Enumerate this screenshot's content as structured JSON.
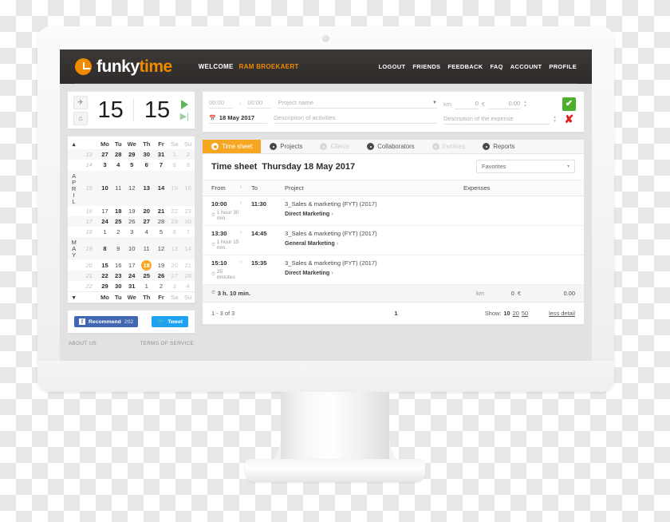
{
  "brand": {
    "logo_first": "funky",
    "logo_second": "time",
    "accent_color": "#f5a623",
    "header_color": "#2e2b2a"
  },
  "topbar": {
    "welcome_label": "WELCOME",
    "user_name": "RAM BROEKAERT",
    "nav": [
      "LOGOUT",
      "FRIENDS",
      "FEEDBACK",
      "FAQ",
      "ACCOUNT",
      "PROFILE"
    ]
  },
  "timer": {
    "plane_icon": "airplane-icon",
    "home_icon": "home-icon",
    "digit_left": "15",
    "digit_right": "15",
    "play_icon": "play-icon",
    "skip_icon": "skip-icon"
  },
  "entry_form": {
    "from_time": "00:00",
    "arrow": "›",
    "to_time": "00:00",
    "project_placeholder": "Project name",
    "date_value": "18 May 2017",
    "activity_placeholder": "Description of activities",
    "km_label": "km",
    "km_value": "0",
    "currency_label": "€",
    "amount_value": "0.00",
    "expense_placeholder": "Description of the expense",
    "confirm_glyph": "✔",
    "cancel_glyph": "✘"
  },
  "calendar": {
    "weekdays": [
      "Mo",
      "Tu",
      "We",
      "Th",
      "Fr",
      "Sa",
      "Su"
    ],
    "nav_up": "▴",
    "nav_down": "▾",
    "months": [
      "APRIL",
      "MAY"
    ],
    "rows": [
      {
        "week": "13",
        "month": "",
        "days": [
          {
            "d": "27",
            "style": "bold"
          },
          {
            "d": "28",
            "style": "bold"
          },
          {
            "d": "29",
            "style": "bold"
          },
          {
            "d": "30",
            "style": "bold"
          },
          {
            "d": "31",
            "style": "bold"
          },
          {
            "d": "1",
            "style": "dim"
          },
          {
            "d": "2",
            "style": "dim"
          }
        ]
      },
      {
        "week": "14",
        "month": "",
        "days": [
          {
            "d": "3",
            "style": "bold"
          },
          {
            "d": "4",
            "style": "bold"
          },
          {
            "d": "5",
            "style": "bold"
          },
          {
            "d": "6",
            "style": "bold"
          },
          {
            "d": "7",
            "style": "bold"
          },
          {
            "d": "8",
            "style": "dim"
          },
          {
            "d": "9",
            "style": "dim"
          }
        ]
      },
      {
        "week": "15",
        "month": "APRIL",
        "days": [
          {
            "d": "10",
            "style": "bold"
          },
          {
            "d": "11",
            "style": "normal"
          },
          {
            "d": "12",
            "style": "normal"
          },
          {
            "d": "13",
            "style": "bold"
          },
          {
            "d": "14",
            "style": "bold"
          },
          {
            "d": "15",
            "style": "dim"
          },
          {
            "d": "16",
            "style": "dim"
          }
        ]
      },
      {
        "week": "16",
        "month": "",
        "days": [
          {
            "d": "17",
            "style": "normal"
          },
          {
            "d": "18",
            "style": "bold"
          },
          {
            "d": "19",
            "style": "normal"
          },
          {
            "d": "20",
            "style": "bold"
          },
          {
            "d": "21",
            "style": "bold"
          },
          {
            "d": "22",
            "style": "dim"
          },
          {
            "d": "23",
            "style": "dim"
          }
        ]
      },
      {
        "week": "17",
        "month": "",
        "days": [
          {
            "d": "24",
            "style": "bold"
          },
          {
            "d": "25",
            "style": "bold"
          },
          {
            "d": "26",
            "style": "normal"
          },
          {
            "d": "27",
            "style": "bold"
          },
          {
            "d": "28",
            "style": "normal"
          },
          {
            "d": "29",
            "style": "dim"
          },
          {
            "d": "30",
            "style": "dim"
          }
        ]
      },
      {
        "week": "18",
        "month": "",
        "days": [
          {
            "d": "1",
            "style": "normal"
          },
          {
            "d": "2",
            "style": "normal"
          },
          {
            "d": "3",
            "style": "normal"
          },
          {
            "d": "4",
            "style": "normal"
          },
          {
            "d": "5",
            "style": "normal"
          },
          {
            "d": "6",
            "style": "dim"
          },
          {
            "d": "7",
            "style": "dim"
          }
        ]
      },
      {
        "week": "19",
        "month": "MAY",
        "days": [
          {
            "d": "8",
            "style": "bold"
          },
          {
            "d": "9",
            "style": "normal"
          },
          {
            "d": "10",
            "style": "normal"
          },
          {
            "d": "11",
            "style": "normal"
          },
          {
            "d": "12",
            "style": "normal"
          },
          {
            "d": "13",
            "style": "dim"
          },
          {
            "d": "14",
            "style": "dim"
          }
        ]
      },
      {
        "week": "20",
        "month": "",
        "days": [
          {
            "d": "15",
            "style": "bold"
          },
          {
            "d": "16",
            "style": "normal"
          },
          {
            "d": "17",
            "style": "normal"
          },
          {
            "d": "18",
            "style": "selected"
          },
          {
            "d": "19",
            "style": "normal"
          },
          {
            "d": "20",
            "style": "dim"
          },
          {
            "d": "21",
            "style": "dim"
          }
        ]
      },
      {
        "week": "21",
        "month": "",
        "days": [
          {
            "d": "22",
            "style": "bold"
          },
          {
            "d": "23",
            "style": "bold"
          },
          {
            "d": "24",
            "style": "bold"
          },
          {
            "d": "25",
            "style": "bold"
          },
          {
            "d": "26",
            "style": "bold"
          },
          {
            "d": "27",
            "style": "dim"
          },
          {
            "d": "28",
            "style": "dim"
          }
        ]
      },
      {
        "week": "22",
        "month": "",
        "days": [
          {
            "d": "29",
            "style": "bold"
          },
          {
            "d": "30",
            "style": "bold"
          },
          {
            "d": "31",
            "style": "bold"
          },
          {
            "d": "1",
            "style": "normal"
          },
          {
            "d": "2",
            "style": "normal"
          },
          {
            "d": "3",
            "style": "dim"
          },
          {
            "d": "4",
            "style": "dim"
          }
        ]
      }
    ]
  },
  "social": {
    "facebook_label": "Recommend",
    "facebook_count": "202",
    "facebook_glyph": "f",
    "twitter_label": "Tweet",
    "twitter_glyph": "✈"
  },
  "footer": {
    "about": "ABOUT US",
    "terms": "TERMS OF SERVICE"
  },
  "tabs": [
    {
      "label": "Time sheet",
      "state": "active",
      "icon": "clock-icon"
    },
    {
      "label": "Projects",
      "state": "normal",
      "icon": "folder-icon"
    },
    {
      "label": "Clients",
      "state": "disabled",
      "icon": "person-icon"
    },
    {
      "label": "Collaborators",
      "state": "normal",
      "icon": "people-icon"
    },
    {
      "label": "Invoices",
      "state": "disabled",
      "icon": "invoice-icon"
    },
    {
      "label": "Reports",
      "state": "normal",
      "icon": "chart-icon"
    }
  ],
  "sheet": {
    "title": "Time sheet",
    "date": "Thursday 18 May 2017",
    "favorites_label": "Favorites",
    "caret": "▾",
    "columns": {
      "from": "From",
      "arrow": "›",
      "to": "To",
      "project": "Project",
      "expenses": "Expenses"
    },
    "rows": [
      {
        "from": "10:00",
        "arrow": "›",
        "to": "11:30",
        "duration": "1 hour 30 min.",
        "project": "3_Sales & marketing (FYT) (2017)",
        "task": "Direct Marketing",
        "chevron": "›",
        "expense": ""
      },
      {
        "from": "13:30",
        "arrow": "›",
        "to": "14:45",
        "duration": "1 hour 15 min.",
        "project": "3_Sales & marketing (FYT) (2017)",
        "task": "General Marketing",
        "chevron": "›",
        "expense": ""
      },
      {
        "from": "15:10",
        "arrow": "›",
        "to": "15:35",
        "duration": "25 minutes",
        "project": "3_Sales & marketing (FYT) (2017)",
        "task": "Direct Marketing",
        "chevron": "›",
        "expense": ""
      }
    ],
    "totals": {
      "time": "3 h. 10 min.",
      "km_label": "km",
      "km_value": "0",
      "currency_label": "€",
      "amount_value": "0.00"
    },
    "pager": {
      "count": "1 - 3 of 3",
      "current_page": "1",
      "show_label": "Show:",
      "show_options": [
        "10",
        "20",
        "50"
      ],
      "show_selected": "10",
      "less_detail": "less detail"
    }
  }
}
